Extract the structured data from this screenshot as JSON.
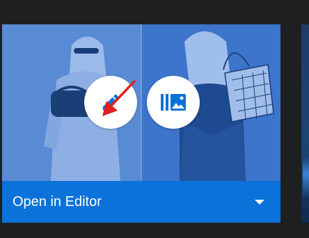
{
  "card": {
    "action_label": "Open in Editor",
    "accent": "#0b72d9",
    "thumbnail_alt": "two-women-fashion-photo"
  },
  "icons": {
    "edit": "pencil-icon",
    "library": "image-library-icon",
    "dropdown": "caret-down-icon",
    "annotation": "red-arrow-icon"
  },
  "colors": {
    "background": "#1e1f21",
    "arrow": "#e02020"
  }
}
